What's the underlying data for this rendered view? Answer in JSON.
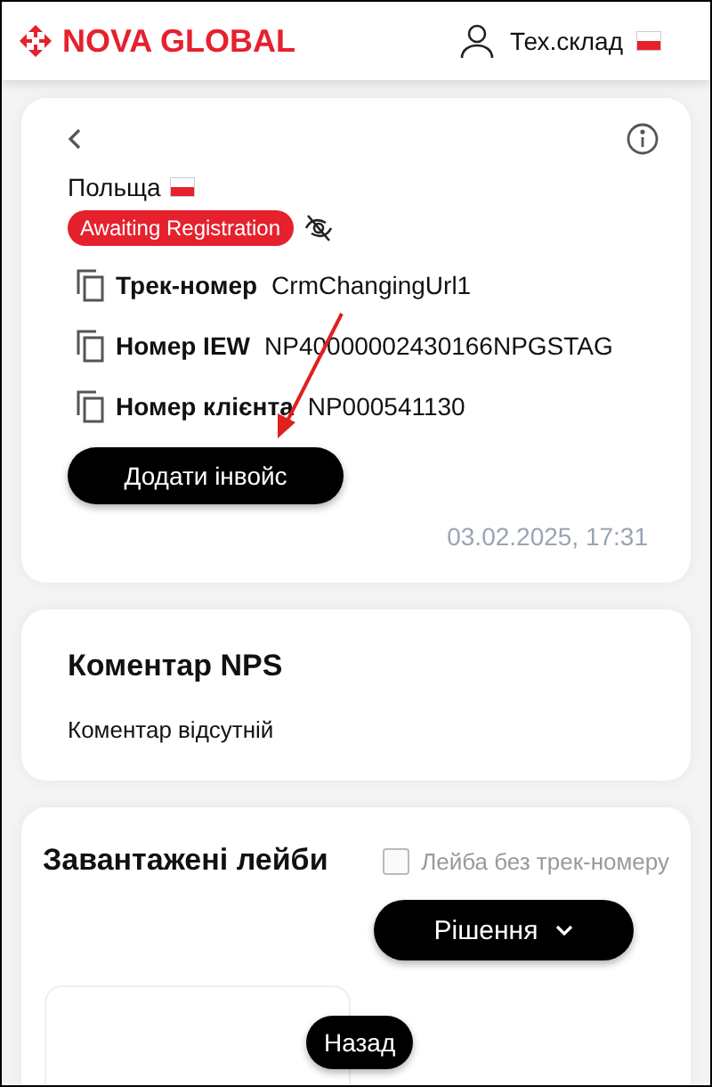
{
  "header": {
    "logo": "NOVA GLOBAL",
    "user": "Тех.склад"
  },
  "shipment": {
    "country": "Польща",
    "status": "Awaiting Registration",
    "fields": [
      {
        "label": "Трек-номер",
        "value": "CrmChangingUrl1"
      },
      {
        "label": "Номер IEW",
        "value": "NP40000002430166NPGSTAG"
      },
      {
        "label": "Номер клієнта",
        "value": "NP000541130"
      }
    ],
    "button": "Додати інвойс",
    "date": "03.02.2025, 17:31"
  },
  "nps": {
    "title": "Коментар NPS",
    "text": "Коментар відсутній"
  },
  "labels": {
    "title": "Завантажені лейби",
    "checkbox": {
      "label": "Лейба без трек-номеру",
      "checked": false,
      "disabled": true
    },
    "dropdown": "Рішення"
  },
  "back_button": "Назад"
}
